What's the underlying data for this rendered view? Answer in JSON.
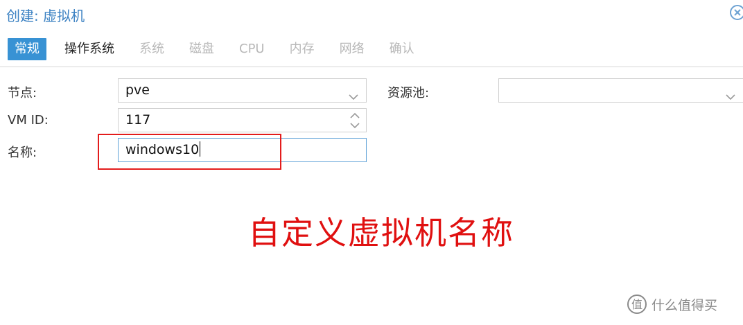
{
  "dialog": {
    "title": "创建: 虚拟机"
  },
  "tabs": [
    {
      "label": "常规",
      "state": "active"
    },
    {
      "label": "操作系统",
      "state": "enabled"
    },
    {
      "label": "系统",
      "state": "disabled"
    },
    {
      "label": "磁盘",
      "state": "disabled"
    },
    {
      "label": "CPU",
      "state": "disabled"
    },
    {
      "label": "内存",
      "state": "disabled"
    },
    {
      "label": "网络",
      "state": "disabled"
    },
    {
      "label": "确认",
      "state": "disabled"
    }
  ],
  "form": {
    "node": {
      "label": "节点:",
      "value": "pve"
    },
    "pool": {
      "label": "资源池:",
      "value": ""
    },
    "vmid": {
      "label": "VM ID:",
      "value": "117"
    },
    "name": {
      "label": "名称:",
      "value": "windows10"
    }
  },
  "annotation": {
    "text": "自定义虚拟机名称",
    "color": "#e01010"
  },
  "watermark": {
    "text": "什么值得买"
  },
  "colors": {
    "accent": "#3892d4",
    "title": "#3a80c2",
    "disabled_tab": "#b8b8b8",
    "highlight": "#e31c1c"
  },
  "icons": {
    "close": "close-icon",
    "dropdown": "chevron-down-icon",
    "spinner": "spinner-icon",
    "logo": "smzdm-logo-icon"
  }
}
